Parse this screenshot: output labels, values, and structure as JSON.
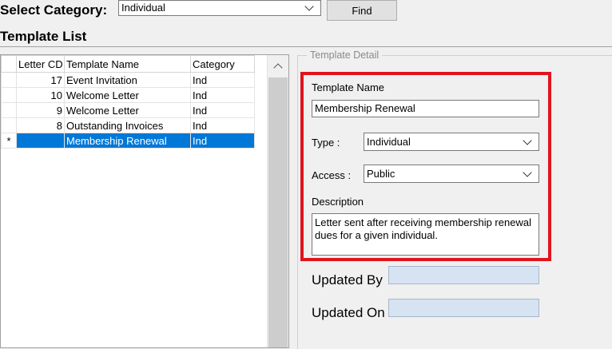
{
  "header": {
    "category_label": "Select Category:",
    "category_value": "Individual",
    "find_label": "Find",
    "template_list_label": "Template List"
  },
  "grid": {
    "columns": [
      "Letter CD",
      "Template Name",
      "Category"
    ],
    "rows": [
      {
        "marker": "",
        "cd": "17",
        "name": "Event Invitation",
        "category": "Ind"
      },
      {
        "marker": "",
        "cd": "10",
        "name": "Welcome Letter",
        "category": "Ind"
      },
      {
        "marker": "",
        "cd": "9",
        "name": "Welcome Letter",
        "category": "Ind"
      },
      {
        "marker": "",
        "cd": "8",
        "name": "Outstanding Invoices",
        "category": "Ind"
      },
      {
        "marker": "*",
        "cd": "",
        "name": "Membership Renewal",
        "category": "Ind"
      }
    ],
    "selected_row": 4
  },
  "detail": {
    "group_title": "Template Detail",
    "name_label": "Template Name",
    "name_value": "Membership Renewal",
    "type_label": "Type :",
    "type_value": "Individual",
    "access_label": "Access :",
    "access_value": "Public",
    "description_label": "Description",
    "description_value": "Letter sent after receiving membership renewal dues for a given individual.",
    "updated_by_label": "Updated By",
    "updated_by_value": "",
    "updated_on_label": "Updated On",
    "updated_on_value": ""
  },
  "colors": {
    "highlight_border": "#e0141c",
    "selection": "#0078d7",
    "readonly_field": "#d5e3f3"
  }
}
